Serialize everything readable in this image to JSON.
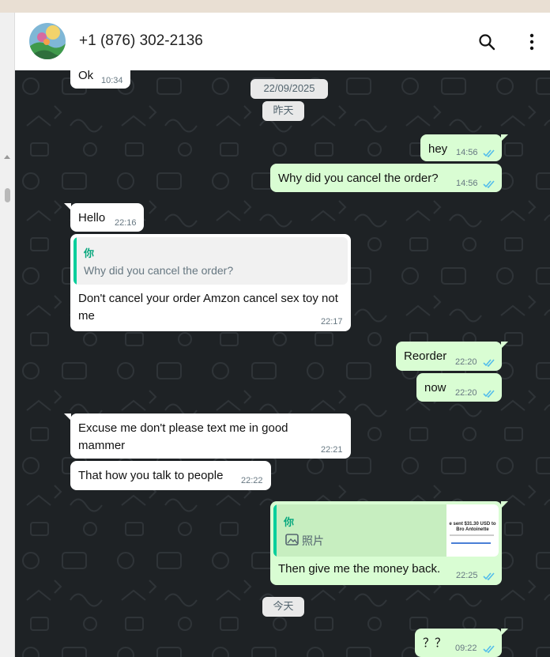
{
  "header": {
    "contact_name": "+1 (876) 302-2136"
  },
  "messages": [
    {
      "id": "m0",
      "dir": "in",
      "text": "Ok",
      "time": "10:34"
    },
    {
      "id": "d1",
      "type": "date",
      "text": "22/09/2025"
    },
    {
      "id": "d2",
      "type": "date",
      "text": "昨天"
    },
    {
      "id": "m1",
      "dir": "out",
      "text": "hey",
      "time": "14:56"
    },
    {
      "id": "m2",
      "dir": "out",
      "text": "Why did you cancel the order?",
      "time": "14:56"
    },
    {
      "id": "m3",
      "dir": "in",
      "text": "Hello",
      "time": "22:16"
    },
    {
      "id": "m4",
      "dir": "in",
      "quote_author": "你",
      "quote_text": "Why did you cancel the order?",
      "text": "Don't cancel  your order Amzon cancel sex toy not me",
      "time": "22:17"
    },
    {
      "id": "m5",
      "dir": "out",
      "text": "Reorder",
      "time": "22:20"
    },
    {
      "id": "m6",
      "dir": "out",
      "text": "now",
      "time": "22:20"
    },
    {
      "id": "m7",
      "dir": "in",
      "text": "Excuse me don't   please text me in good mammer",
      "time": "22:21"
    },
    {
      "id": "m8",
      "dir": "in",
      "text": "That how you talk to people",
      "time": "22:22"
    },
    {
      "id": "m9",
      "dir": "out",
      "quote_author": "你",
      "quote_text": "照片",
      "quote_thumb_text": "e sent $31.30 USD to Bro Antoinette",
      "text": "Then give me the money back.",
      "time": "22:25"
    },
    {
      "id": "d3",
      "type": "date",
      "text": "今天"
    },
    {
      "id": "m10",
      "dir": "out",
      "text": "？？",
      "time": "09:22"
    }
  ],
  "colors": {
    "chat_bg": "#1e2225",
    "bubble_in": "#ffffff",
    "bubble_out": "#d9fdd3",
    "read_ticks": "#53bdeb",
    "quote_accent": "#06cf9c"
  },
  "icons": {
    "search": "search-icon",
    "menu": "more-vertical-icon",
    "read_receipt": "double-check-icon",
    "photo": "image-icon"
  }
}
